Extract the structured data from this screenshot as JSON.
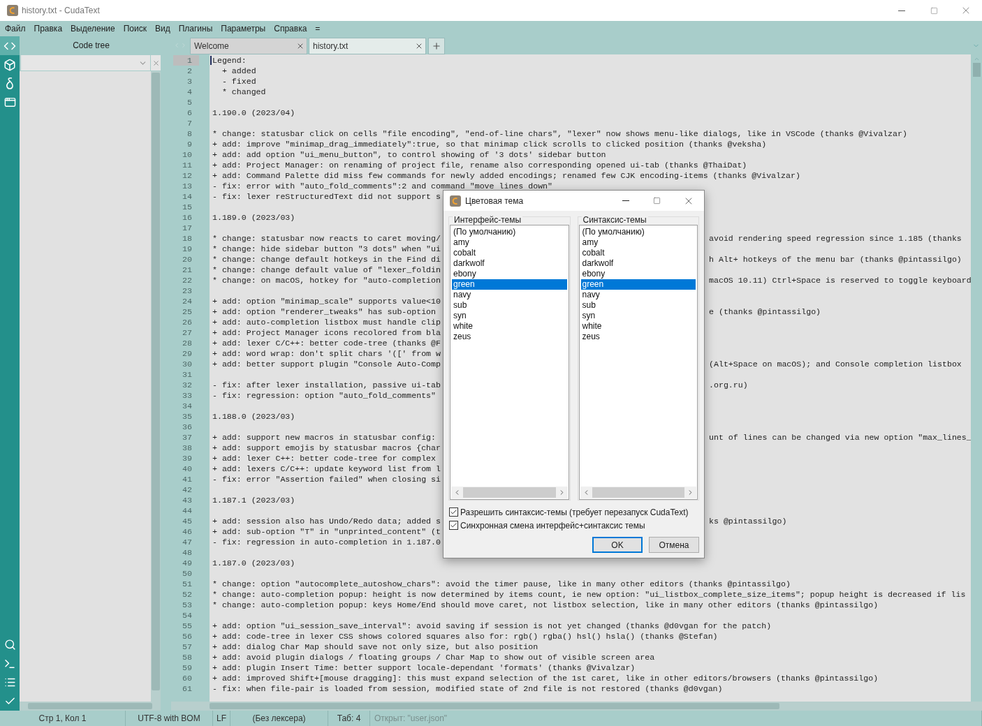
{
  "window": {
    "title": "history.txt - CudaText"
  },
  "menu": [
    "Файл",
    "Правка",
    "Выделение",
    "Поиск",
    "Вид",
    "Плагины",
    "Параметры",
    "Справка",
    "="
  ],
  "side_buttons_top": [
    {
      "kind": "code",
      "selected": true
    },
    {
      "kind": "cube",
      "selected": false
    },
    {
      "kind": "delta",
      "selected": false
    },
    {
      "kind": "window",
      "selected": false
    }
  ],
  "side_buttons_bottom": [
    {
      "kind": "search"
    },
    {
      "kind": "terminal"
    },
    {
      "kind": "list"
    },
    {
      "kind": "check"
    }
  ],
  "panel": {
    "title": "Code tree"
  },
  "tabs": [
    {
      "label": "Welcome",
      "selected": false
    },
    {
      "label": "history.txt",
      "selected": true
    }
  ],
  "editor": {
    "lines": [
      {
        "number": "1",
        "current": true,
        "text": "Legend:"
      },
      {
        "number": "2",
        "current": false,
        "text": "  + added"
      },
      {
        "number": "3",
        "current": false,
        "text": "  - fixed"
      },
      {
        "number": "4",
        "current": false,
        "text": "  * changed"
      },
      {
        "number": "5",
        "current": false
      },
      {
        "number": "6",
        "current": false,
        "text": "1.190.0 (2023/04)"
      },
      {
        "number": "7",
        "current": false
      },
      {
        "number": "8",
        "current": false,
        "text": "* change: statusbar click on cells \"file encoding\", \"end-of-line chars\", \"lexer\" now shows menu-like dialogs, like in VSCode (thanks @Vivalzar)"
      },
      {
        "number": "9",
        "current": false,
        "text": "+ add: improve \"minimap_drag_immediately\":true, so that minimap click scrolls to clicked position (thanks @veksha)"
      },
      {
        "number": "10",
        "current": false,
        "text": "+ add: add option \"ui_menu_button\", to control showing of '3 dots' sidebar button"
      },
      {
        "number": "11",
        "current": false,
        "text": "+ add: Project Manager: on renaming of project file, rename also corresponding opened ui-tab (thanks @ThaiDat)"
      },
      {
        "number": "12",
        "current": false,
        "text": "+ add: Command Palette did miss few commands for newly added encodings; renamed few CJK encoding-items (thanks @Vivalzar)"
      },
      {
        "number": "13",
        "current": false,
        "text": "- fix: error with \"auto_fold_comments\":2 and command \"move lines down\""
      },
      {
        "number": "14",
        "current": false,
        "text": "- fix: lexer reStructuredText did not support s"
      },
      {
        "number": "15",
        "current": false
      },
      {
        "number": "16",
        "current": false,
        "text": "1.189.0 (2023/03)"
      },
      {
        "number": "17",
        "current": false
      },
      {
        "number": "18",
        "current": false,
        "text": "* change: statusbar now reacts to caret moving/",
        "tail": "avoid rendering speed regression since 1.185 (thanks"
      },
      {
        "number": "19",
        "current": false,
        "text": "* change: hide sidebar button \"3 dots\" when \"ui"
      },
      {
        "number": "20",
        "current": false,
        "text": "* change: change default hotkeys in the Find di",
        "tail": "h Alt+ hotkeys of the menu bar (thanks @pintassilgo)"
      },
      {
        "number": "21",
        "current": false,
        "text": "* change: change default value of \"lexer_foldin"
      },
      {
        "number": "22",
        "current": false,
        "text": "* change: on macOS, hotkey for \"auto-completion",
        "tail": "macOS 10.11) Ctrl+Space is reserved to toggle keyboard"
      },
      {
        "number": "23",
        "current": false
      },
      {
        "number": "24",
        "current": false,
        "text": "+ add: option \"minimap_scale\" supports value<10"
      },
      {
        "number": "25",
        "current": false,
        "text": "+ add: option \"renderer_tweaks\" has sub-option",
        "tail": "e (thanks @pintassilgo)"
      },
      {
        "number": "26",
        "current": false,
        "text": "+ add: auto-completion listbox must handle clip"
      },
      {
        "number": "27",
        "current": false,
        "text": "+ add: Project Manager icons recolored from bla"
      },
      {
        "number": "28",
        "current": false,
        "text": "+ add: lexer C/C++: better code-tree (thanks @F"
      },
      {
        "number": "29",
        "current": false,
        "text": "+ add: word wrap: don't split chars '([' from w"
      },
      {
        "number": "30",
        "current": false,
        "text": "+ add: better support plugin \"Console Auto-Comp",
        "tail": "(Alt+Space on macOS); and Console completion listbox"
      },
      {
        "number": "31",
        "current": false
      },
      {
        "number": "32",
        "current": false,
        "text": "- fix: after lexer installation, passive ui-tab",
        "tail": ".org.ru)"
      },
      {
        "number": "33",
        "current": false,
        "text": "- fix: regression: option \"auto_fold_comments\""
      },
      {
        "number": "34",
        "current": false
      },
      {
        "number": "35",
        "current": false,
        "text": "1.188.0 (2023/03)"
      },
      {
        "number": "36",
        "current": false
      },
      {
        "number": "37",
        "current": false,
        "text": "+ add: support new macros in statusbar config:",
        "tail": "unt of lines can be changed via new option \"max_lines_"
      },
      {
        "number": "38",
        "current": false,
        "text": "+ add: support emojis by statusbar macros {char"
      },
      {
        "number": "39",
        "current": false,
        "text": "+ add: lexer C++: better code-tree for complex"
      },
      {
        "number": "40",
        "current": false,
        "text": "+ add: lexers C/C++: update keyword list from l"
      },
      {
        "number": "41",
        "current": false,
        "text": "- fix: error \"Assertion failed\" when closing si"
      },
      {
        "number": "42",
        "current": false
      },
      {
        "number": "43",
        "current": false,
        "text": "1.187.1 (2023/03)"
      },
      {
        "number": "44",
        "current": false
      },
      {
        "number": "45",
        "current": false,
        "text": "+ add: session also has Undo/Redo data; added s",
        "tail": "ks @pintassilgo)"
      },
      {
        "number": "46",
        "current": false,
        "text": "+ add: sub-option \"T\" in \"unprinted_content\" (t"
      },
      {
        "number": "47",
        "current": false,
        "text": "- fix: regression in auto-completion in 1.187.0"
      },
      {
        "number": "48",
        "current": false
      },
      {
        "number": "49",
        "current": false,
        "text": "1.187.0 (2023/03)"
      },
      {
        "number": "50",
        "current": false
      },
      {
        "number": "51",
        "current": false,
        "text": "* change: option \"autocomplete_autoshow_chars\": avoid the timer pause, like in many other editors (thanks @pintassilgo)"
      },
      {
        "number": "52",
        "current": false,
        "text": "* change: auto-completion popup: height is now determined by items count, ie new option: \"ui_listbox_complete_size_items\"; popup height is decreased if lis"
      },
      {
        "number": "53",
        "current": false,
        "text": "* change: auto-completion popup: keys Home/End should move caret, not listbox selection, like in many other editors (thanks @pintassilgo)"
      },
      {
        "number": "54",
        "current": false
      },
      {
        "number": "55",
        "current": false,
        "text": "+ add: option \"ui_session_save_interval\": avoid saving if session is not yet changed (thanks @d0vgan for the patch)"
      },
      {
        "number": "56",
        "current": false,
        "text": "+ add: code-tree in lexer CSS shows colored squares also for: rgb() rgba() hsl() hsla() (thanks @Stefan)"
      },
      {
        "number": "57",
        "current": false,
        "text": "+ add: dialog Char Map should save not only size, but also position"
      },
      {
        "number": "58",
        "current": false,
        "text": "+ add: avoid plugin dialogs / floating groups / Char Map to show out of visible screen area"
      },
      {
        "number": "59",
        "current": false,
        "text": "+ add: plugin Insert Time: better support locale-dependant 'formats' (thanks @Vivalzar)"
      },
      {
        "number": "60",
        "current": false,
        "text": "+ add: improved Shift+[mouse dragging]: this must expand selection of the 1st caret, like in other editors/browsers (thanks @pintassilgo)"
      },
      {
        "number": "61",
        "current": false,
        "text": "- fix: when file-pair is loaded from session, modified state of 2nd file is not restored (thanks @d0vgan)"
      }
    ]
  },
  "dialog": {
    "title": "Цветовая тема",
    "groups": [
      {
        "title": "Интерфейс-темы",
        "items": [
          {
            "label": "(По умолчанию)",
            "selected": false
          },
          {
            "label": "amy",
            "selected": false
          },
          {
            "label": "cobalt",
            "selected": false
          },
          {
            "label": "darkwolf",
            "selected": false
          },
          {
            "label": "ebony",
            "selected": false
          },
          {
            "label": "green",
            "selected": true
          },
          {
            "label": "navy",
            "selected": false
          },
          {
            "label": "sub",
            "selected": false
          },
          {
            "label": "syn",
            "selected": false
          },
          {
            "label": "white",
            "selected": false
          },
          {
            "label": "zeus",
            "selected": false
          }
        ]
      },
      {
        "title": "Синтаксис-темы",
        "items": [
          {
            "label": "(По умолчанию)",
            "selected": false
          },
          {
            "label": "amy",
            "selected": false
          },
          {
            "label": "cobalt",
            "selected": false
          },
          {
            "label": "darkwolf",
            "selected": false
          },
          {
            "label": "ebony",
            "selected": false
          },
          {
            "label": "green",
            "selected": true
          },
          {
            "label": "navy",
            "selected": false
          },
          {
            "label": "sub",
            "selected": false
          },
          {
            "label": "syn",
            "selected": false
          },
          {
            "label": "white",
            "selected": false
          },
          {
            "label": "zeus",
            "selected": false
          }
        ]
      }
    ],
    "options": [
      {
        "label": "Разрешить синтаксис-темы (требует перезапуск CudaText)",
        "checked": true
      },
      {
        "label": "Синхронная смена интерфейс+синтаксис темы",
        "checked": true
      }
    ],
    "buttons": [
      {
        "label": "OK",
        "default": true
      },
      {
        "label": "Отмена",
        "default": false
      }
    ]
  },
  "status_bar": [
    {
      "text": "Стр 1, Кол 1",
      "dim": false
    },
    {
      "text": "UTF-8 with BOM",
      "dim": false
    },
    {
      "text": "LF",
      "dim": false
    },
    {
      "text": "(Без лексера)",
      "dim": false
    },
    {
      "text": "Таб: 4",
      "dim": false
    },
    {
      "text": "Открыт: \"user.json\"",
      "dim": true
    }
  ]
}
